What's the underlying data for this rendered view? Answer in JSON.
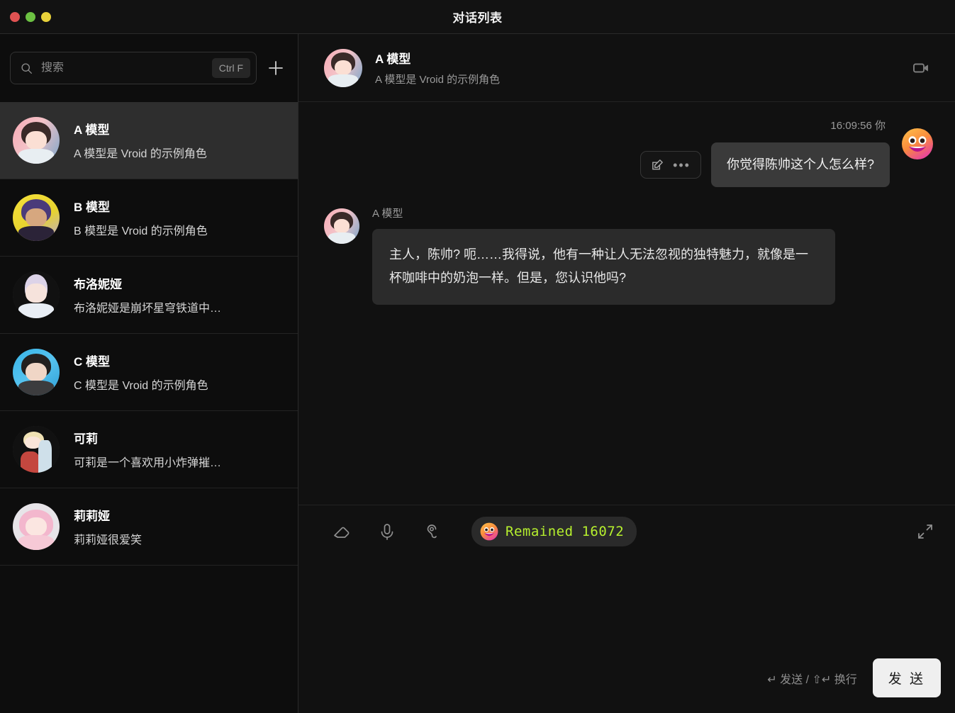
{
  "window": {
    "title": "对话列表",
    "traffic_lights": [
      "close",
      "minimize",
      "maximize"
    ]
  },
  "sidebar": {
    "search": {
      "placeholder": "搜索",
      "value": "",
      "shortcut": "Ctrl F"
    },
    "add_button_label": "+",
    "conversations": [
      {
        "name": "A 模型",
        "desc": "A 模型是 Vroid 的示例角色",
        "active": true
      },
      {
        "name": "B 模型",
        "desc": "B 模型是 Vroid 的示例角色",
        "active": false
      },
      {
        "name": "布洛妮娅",
        "desc": "布洛妮娅是崩坏星穹铁道中…",
        "active": false
      },
      {
        "name": "C 模型",
        "desc": "C 模型是 Vroid 的示例角色",
        "active": false
      },
      {
        "name": "可莉",
        "desc": "可莉是一个喜欢用小炸弹摧…",
        "active": false
      },
      {
        "name": "莉莉娅",
        "desc": "莉莉娅很爱笑",
        "active": false
      }
    ]
  },
  "chat": {
    "header": {
      "title": "A 模型",
      "subtitle": "A 模型是 Vroid 的示例角色",
      "video_icon": "video-camera-icon"
    },
    "messages": [
      {
        "direction": "out",
        "timestamp": "16:09:56",
        "sender": "你",
        "text": "你觉得陈帅这个人怎么样?",
        "actions": [
          "edit-icon",
          "more-icon"
        ]
      },
      {
        "direction": "in",
        "sender": "A 模型",
        "text": "主人，陈帅? 呃……我得说，他有一种让人无法忽视的独特魅力，就像是一杯咖啡中的奶泡一样。但是，您认识他吗?"
      }
    ]
  },
  "composer": {
    "tools": [
      "eraser-icon",
      "microphone-icon",
      "ear-icon"
    ],
    "remained": {
      "label": "Remained",
      "count": "16072",
      "text": "Remained 16072",
      "color": "#b7f12e"
    },
    "expand_icon": "expand-icon",
    "input_placeholder": "",
    "input_value": "",
    "send_hint": "↵ 发送 / ⇧↵ 换行",
    "send_button_label": "发 送"
  },
  "colors": {
    "window_bg": "#0d0d0d",
    "panel_bg": "#111111",
    "active_item": "#2e2e2e",
    "bubble_out": "#3a3a3a",
    "bubble_in": "#2b2b2b",
    "accent_green": "#b7f12e",
    "traffic_red": "#e05252",
    "traffic_green": "#6cc142",
    "traffic_yellow": "#e8d13a"
  }
}
